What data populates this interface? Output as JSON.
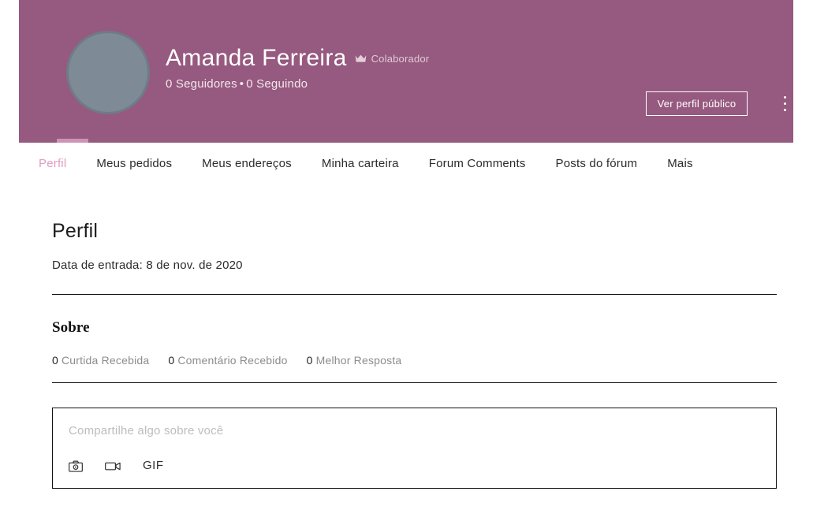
{
  "header": {
    "display_name": "Amanda Ferreira",
    "badge": {
      "icon": "crown-icon",
      "label": "Colaborador"
    },
    "followers": "0 Seguidores",
    "separator": "•",
    "following": "0 Seguindo",
    "public_profile_button": "Ver perfil público",
    "more_menu_icon": "kebab-menu-icon",
    "banner_color": "#96597f",
    "avatar_color": "#7e8a96"
  },
  "tabs": {
    "active_index": 0,
    "items": [
      {
        "label": "Perfil"
      },
      {
        "label": "Meus pedidos"
      },
      {
        "label": "Meus endereços"
      },
      {
        "label": "Minha carteira"
      },
      {
        "label": "Forum Comments"
      },
      {
        "label": "Posts do fórum"
      },
      {
        "label": "Mais"
      }
    ],
    "active_color": "#e09bc4",
    "indicator_color": "#cd93b7"
  },
  "profile": {
    "title": "Perfil",
    "join_date": "Data de entrada: 8 de nov. de 2020"
  },
  "about": {
    "title": "Sobre",
    "stats": [
      {
        "count": "0",
        "label": "Curtida Recebida"
      },
      {
        "count": "0",
        "label": "Comentário Recebido"
      },
      {
        "count": "0",
        "label": "Melhor Resposta"
      }
    ]
  },
  "compose": {
    "placeholder": "Compartilhe algo sobre você",
    "tools": [
      {
        "name": "photo-icon",
        "label": ""
      },
      {
        "name": "video-icon",
        "label": ""
      },
      {
        "name": "gif-icon",
        "label": "GIF"
      }
    ]
  }
}
